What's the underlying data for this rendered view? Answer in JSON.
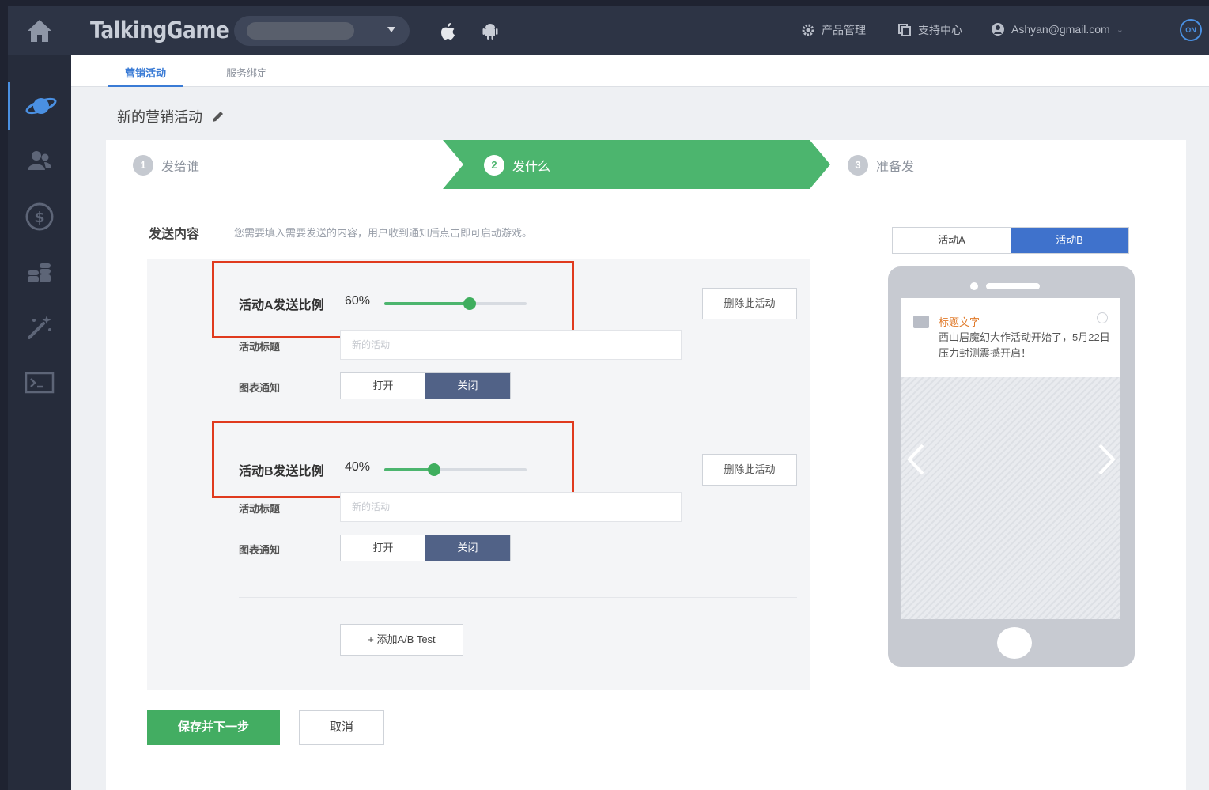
{
  "header": {
    "brand": "TalkingGame",
    "nav": [
      {
        "label": "产品管理",
        "icon": "gear-icon"
      },
      {
        "label": "支持中心",
        "icon": "copy-icon"
      },
      {
        "label": "Ashyan@gmail.com",
        "icon": "user-icon"
      }
    ],
    "badge": "ON"
  },
  "sidebar": {
    "items": [
      {
        "icon": "planet-icon",
        "active": true
      },
      {
        "icon": "users-icon"
      },
      {
        "icon": "dollar-icon"
      },
      {
        "icon": "coins-icon"
      },
      {
        "icon": "magic-wand-icon"
      },
      {
        "icon": "terminal-icon"
      }
    ]
  },
  "tabs": [
    {
      "label": "营销活动",
      "active": true
    },
    {
      "label": "服务绑定"
    }
  ],
  "page_title": "新的营销活动",
  "steps": [
    {
      "num": "1",
      "label": "发给谁"
    },
    {
      "num": "2",
      "label": "发什么",
      "active": true
    },
    {
      "num": "3",
      "label": "准备发"
    }
  ],
  "section": {
    "label": "发送内容",
    "hint": "您需要填入需要发送的内容，用户收到通知后点击即可启动游戏。"
  },
  "activities": [
    {
      "ratio_label": "活动A发送比例",
      "ratio_value": "60%",
      "ratio": 0.6,
      "delete_label": "删除此活动",
      "title_label": "活动标题",
      "title_placeholder": "新的活动",
      "notify_label": "图表通知",
      "toggle_open": "打开",
      "toggle_close": "关闭"
    },
    {
      "ratio_label": "活动B发送比例",
      "ratio_value": "40%",
      "ratio": 0.35,
      "delete_label": "删除此活动",
      "title_label": "活动标题",
      "title_placeholder": "新的活动",
      "notify_label": "图表通知",
      "toggle_open": "打开",
      "toggle_close": "关闭"
    }
  ],
  "add_test_label": "+ 添加A/B Test",
  "actions": {
    "save": "保存并下一步",
    "cancel": "取消"
  },
  "preview": {
    "tab_a": "活动A",
    "tab_b": "活动B",
    "notif_title": "标题文字",
    "notif_body": "西山居魔幻大作活动开始了，5月22日压力封测震撼开启！"
  },
  "colors": {
    "accent_green": "#43ad62",
    "accent_blue": "#3f72cc",
    "highlight_red": "#e03a1e",
    "topbar": "#2d3445"
  }
}
